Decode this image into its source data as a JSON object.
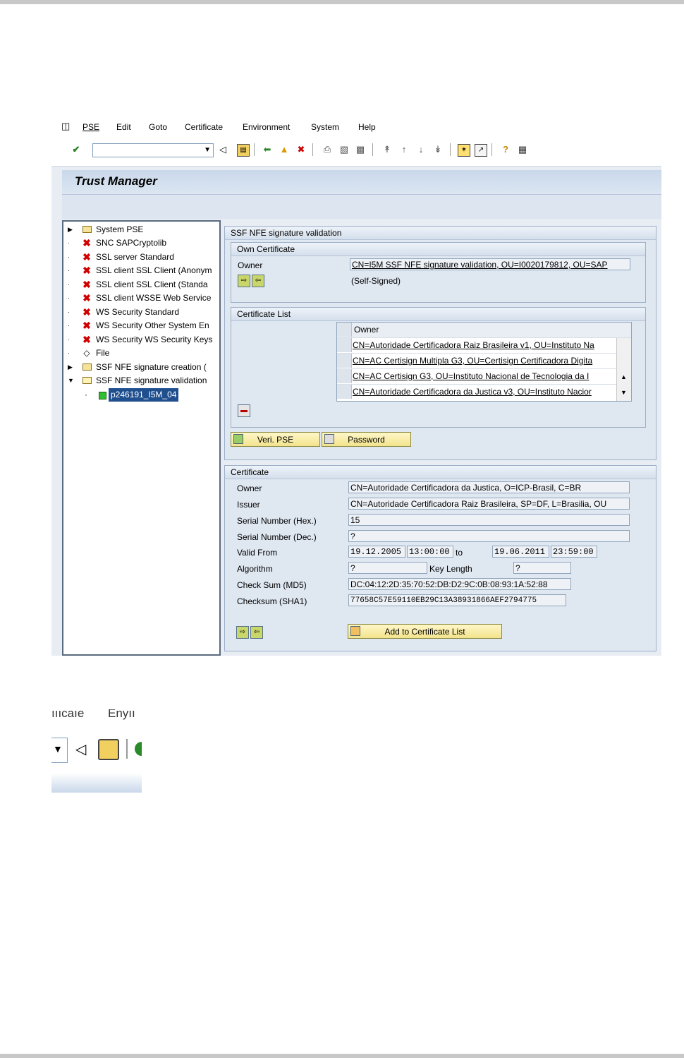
{
  "menu": [
    "PSE",
    "Edit",
    "Goto",
    "Certificate",
    "Environment",
    "System",
    "Help"
  ],
  "menu_underline": [
    "P",
    "E",
    "G",
    "C",
    "v",
    "S",
    "H"
  ],
  "toolbar_icons": [
    "enter-icon",
    "back-icon",
    "save-icon",
    "back-green-icon",
    "exit-icon",
    "cancel-icon",
    "print-icon",
    "find-icon",
    "find-next-icon",
    "first-page-icon",
    "prev-page-icon",
    "next-page-icon",
    "last-page-icon",
    "new-session-icon",
    "shortcut-icon",
    "help-icon",
    "layout-icon"
  ],
  "title": "Trust Manager",
  "tree": [
    {
      "label": "System PSE",
      "exp": "right",
      "icon": "folder"
    },
    {
      "label": "SNC SAPCryptolib",
      "exp": "dot",
      "icon": "x"
    },
    {
      "label": "SSL server Standard",
      "exp": "dot",
      "icon": "x"
    },
    {
      "label": "SSL client SSL Client (Anonym",
      "exp": "dot",
      "icon": "x"
    },
    {
      "label": "SSL client SSL Client (Standa",
      "exp": "dot",
      "icon": "x"
    },
    {
      "label": "SSL client WSSE Web Service",
      "exp": "dot",
      "icon": "x"
    },
    {
      "label": "WS Security Standard",
      "exp": "dot",
      "icon": "x"
    },
    {
      "label": "WS Security Other System En",
      "exp": "dot",
      "icon": "x"
    },
    {
      "label": "WS Security WS Security Keys",
      "exp": "dot",
      "icon": "x"
    },
    {
      "label": "File",
      "exp": "dot",
      "icon": "file"
    },
    {
      "label": "SSF NFE signature creation (",
      "exp": "right",
      "icon": "folder"
    },
    {
      "label": "SSF NFE signature validation",
      "exp": "down",
      "icon": "folder-open"
    }
  ],
  "tree_selected": "p246191_I5M_04",
  "pse_panel": {
    "title": "SSF NFE signature validation",
    "own_cert_title": "Own Certificate",
    "owner_label": "Owner",
    "owner_value": "CN=I5M SSF NFE signature validation, OU=I0020179812, OU=SAP",
    "self_signed": "(Self-Signed)",
    "cert_list_title": "Certificate List",
    "list_header": "Owner",
    "list_rows": [
      "CN=Autoridade Certificadora Raiz Brasileira v1, OU=Instituto Na",
      "CN=AC Certisign Multipla G3, OU=Certisign Certificadora Digita",
      "CN=AC Certisign G3, OU=Instituto Nacional de Tecnologia da I",
      "CN=Autoridade Certificadora da Justica v3, OU=Instituto Nacior"
    ],
    "veri_pse_button": "Veri. PSE",
    "password_button": "Password"
  },
  "certificate": {
    "title": "Certificate",
    "labels": {
      "owner": "Owner",
      "issuer": "Issuer",
      "serial_hex": "Serial Number (Hex.)",
      "serial_dec": "Serial Number (Dec.)",
      "valid_from": "Valid From",
      "algorithm": "Algorithm",
      "md5": "Check Sum (MD5)",
      "sha1": "Checksum (SHA1)",
      "to": "to",
      "key_length": "Key Length"
    },
    "owner": "CN=Autoridade Certificadora da Justica, O=ICP-Brasil, C=BR",
    "issuer": "CN=Autoridade Certificadora Raiz Brasileira, SP=DF, L=Brasilia, OU",
    "serial_hex": "15",
    "serial_dec": "?",
    "valid_from_date": "19.12.2005",
    "valid_from_time": "13:00:00",
    "valid_to_date": "19.06.2011",
    "valid_to_time": "23:59:00",
    "algorithm": "?",
    "key_length": "?",
    "md5": "DC:04:12:2D:35:70:52:DB:D2:9C:0B:08:93:1A:52:88",
    "sha1": "77658C57E59110EB29C13A38931866AEF2794775",
    "add_button": "Add to Certificate List"
  },
  "zoom": {
    "fragment1": "ıııcaıe",
    "fragment2": "Enyıı"
  }
}
